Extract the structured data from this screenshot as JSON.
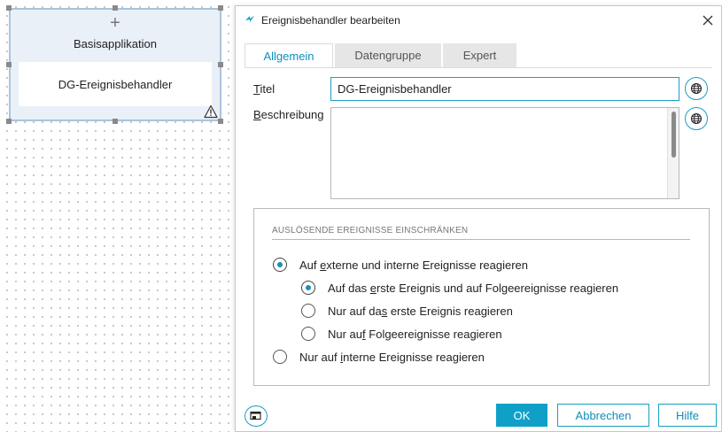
{
  "canvas": {
    "node": {
      "add_symbol": "+",
      "title": "Basisapplikation",
      "inner_label": "DG-Ereignisbehandler",
      "warning_icon": "warning-triangle-icon"
    }
  },
  "dialog": {
    "title": "Ereignisbehandler bearbeiten",
    "title_icon": "lightning-icon",
    "close_icon": "close-icon",
    "tabs": [
      {
        "label": "Allgemein",
        "active": true
      },
      {
        "label": "Datengruppe",
        "active": false
      },
      {
        "label": "Expert",
        "active": false
      }
    ],
    "fields": {
      "title_label_key": "T",
      "title_label_rest": "itel",
      "title_value": "DG-Ereignisbehandler",
      "description_label_key": "B",
      "description_label_rest": "eschreibung",
      "description_value": "",
      "translate_icon": "globe-icon"
    },
    "events_group": {
      "heading": "AUSLÖSENDE EREIGNISSE EINSCHRÄNKEN",
      "options": [
        {
          "pre": "Auf ",
          "key": "e",
          "post": "xterne und interne Ereignisse reagieren",
          "selected": true,
          "level": 0
        },
        {
          "pre": "Auf das ",
          "key": "e",
          "post": "rste Ereignis und auf Folgeereignisse reagieren",
          "selected": true,
          "level": 1
        },
        {
          "pre": "Nur auf da",
          "key": "s",
          "post": " erste Ereignis reagieren",
          "selected": false,
          "level": 1
        },
        {
          "pre": "Nur au",
          "key": "f",
          "post": " Folgeereignisse reagieren",
          "selected": false,
          "level": 1
        },
        {
          "pre": "Nur auf ",
          "key": "i",
          "post": "nterne Ereignisse reagieren",
          "selected": false,
          "level": 0
        }
      ]
    },
    "footer": {
      "tool_icon": "window-restore-icon",
      "ok_label": "OK",
      "cancel_label": "Abbrechen",
      "help_label": "Hilfe"
    }
  },
  "colors": {
    "accent": "#0fa0c8",
    "accent_text": "#0f8fb8",
    "node_fill": "#eaf0f7",
    "node_border": "#a9c3de"
  }
}
